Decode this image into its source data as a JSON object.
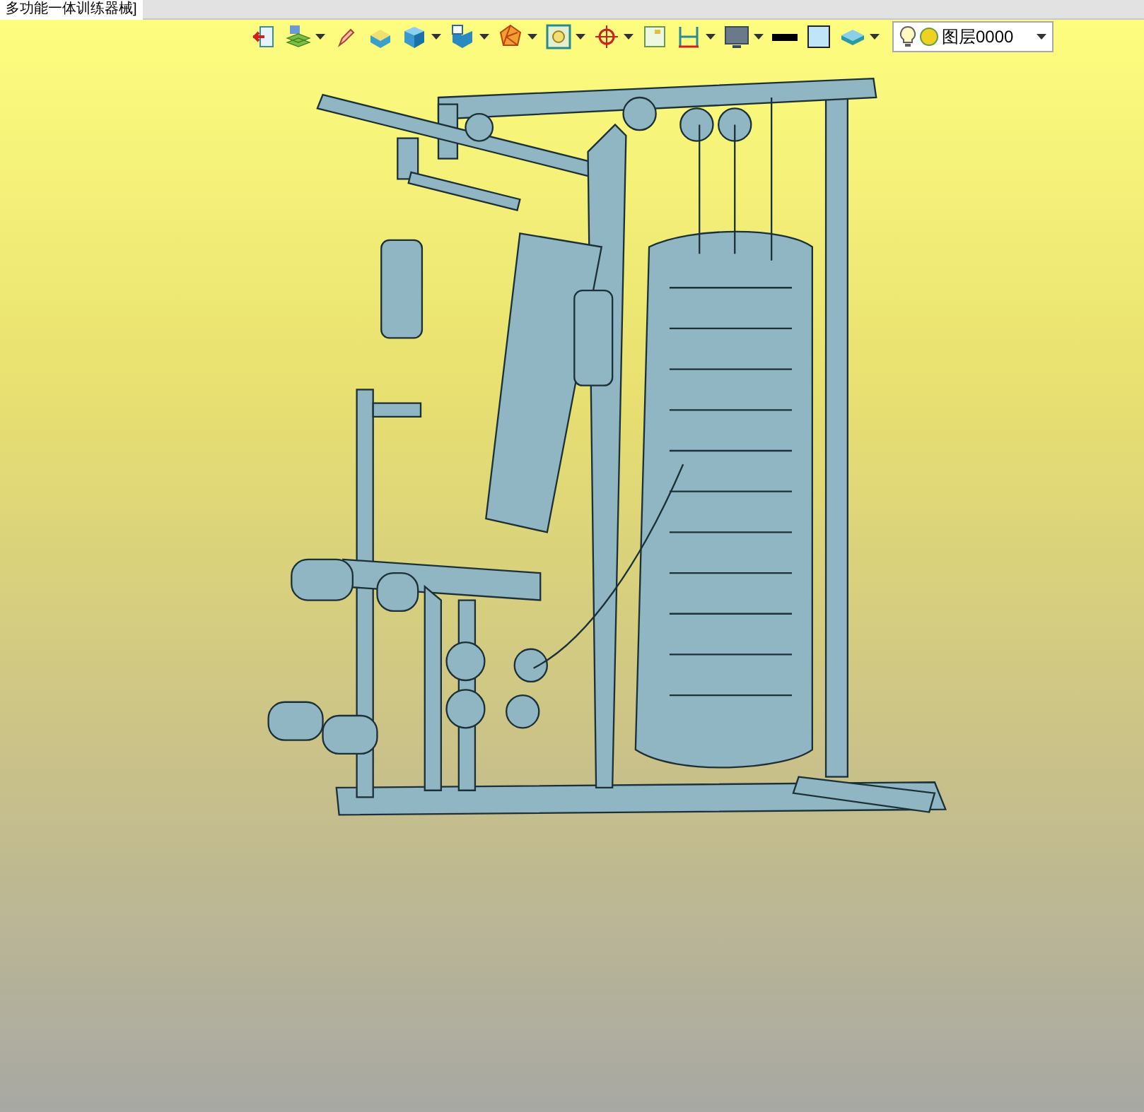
{
  "document_tab": {
    "title": "多功能一体训练器械]",
    "selected": true
  },
  "toolbar": [
    {
      "kind": "exit",
      "dropdown": false
    },
    {
      "kind": "layers",
      "dropdown": true
    },
    {
      "kind": "pen",
      "dropdown": false
    },
    {
      "kind": "box",
      "dropdown": false
    },
    {
      "kind": "cube",
      "dropdown": true
    },
    {
      "kind": "cube-window",
      "dropdown": true
    },
    {
      "kind": "polyhedron",
      "dropdown": true
    },
    {
      "kind": "frame",
      "dropdown": true
    },
    {
      "kind": "target",
      "dropdown": true
    },
    {
      "kind": "small-frame",
      "dropdown": false
    },
    {
      "kind": "dimension",
      "dropdown": true
    },
    {
      "kind": "monitor",
      "dropdown": true
    },
    {
      "kind": "line",
      "dropdown": false
    },
    {
      "kind": "swatch",
      "dropdown": false
    },
    {
      "kind": "stack",
      "dropdown": true
    }
  ],
  "layer_selector": {
    "value": "图层0000"
  }
}
